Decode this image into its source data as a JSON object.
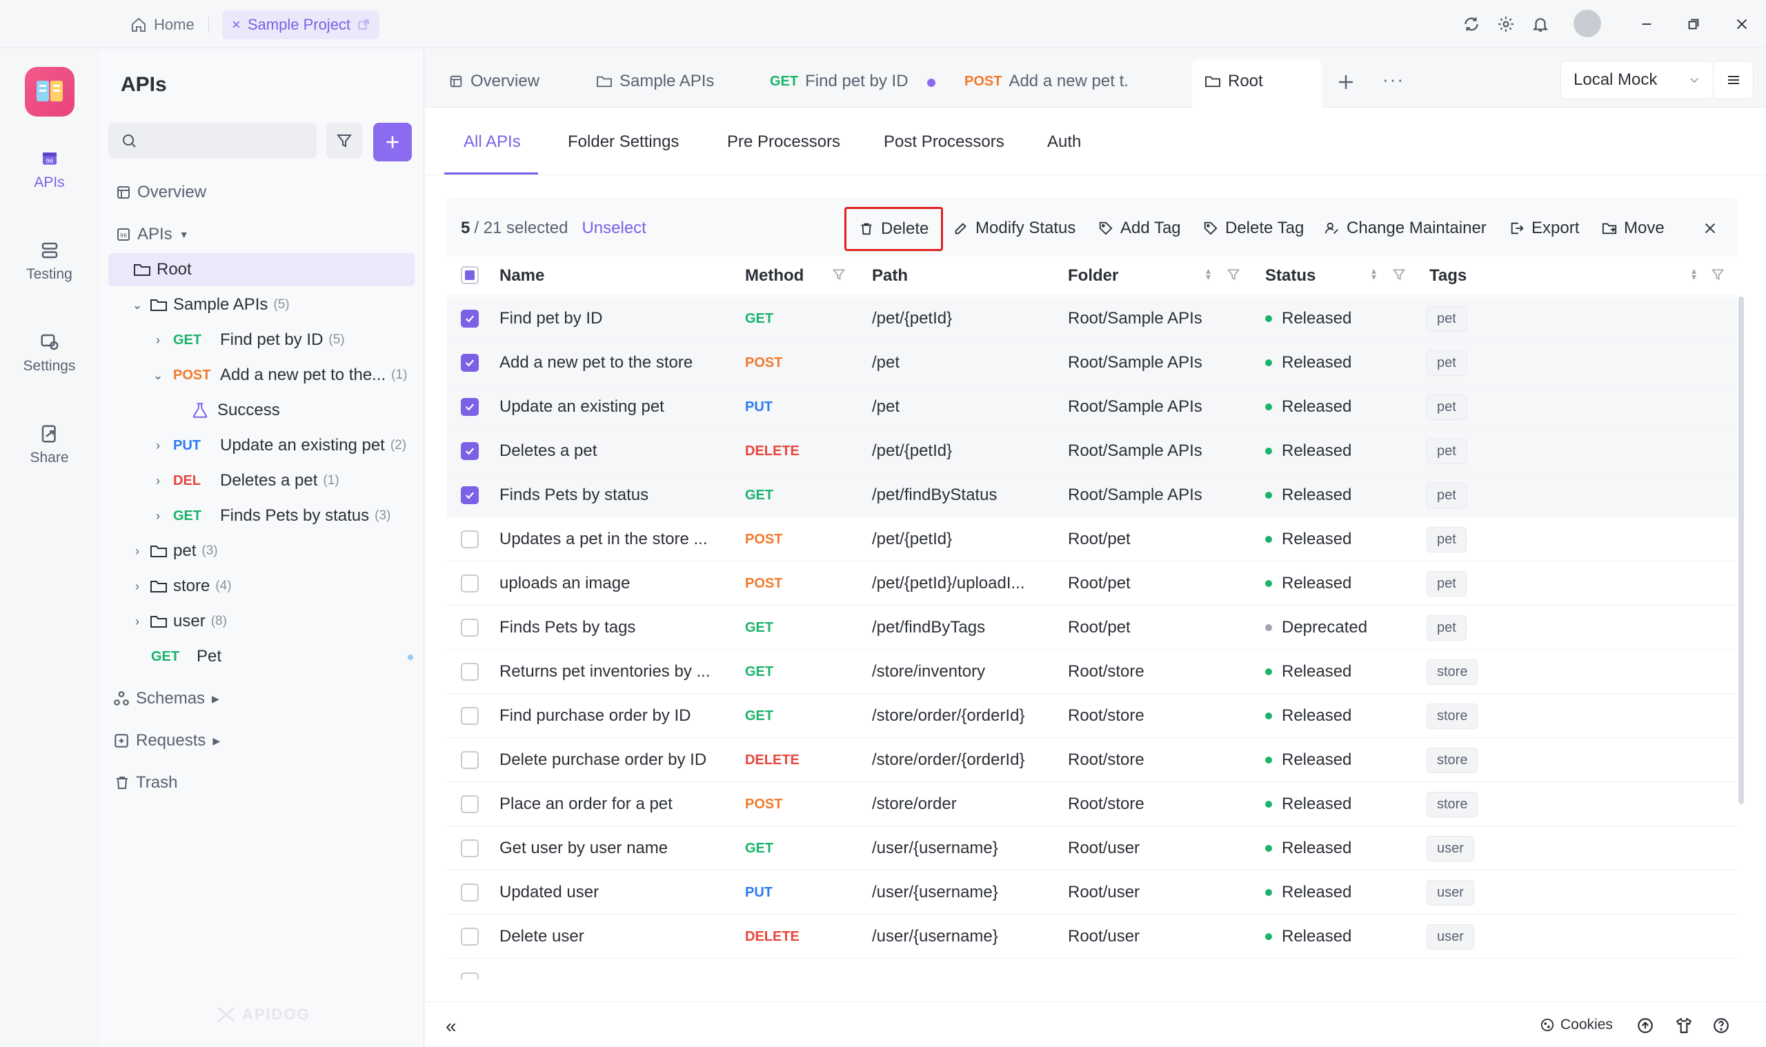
{
  "titlebar": {
    "home_label": "Home",
    "project_tab": "Sample Project"
  },
  "rail": {
    "items": [
      {
        "label": "APIs",
        "icon": "apis-icon"
      },
      {
        "label": "Testing",
        "icon": "testing-icon"
      },
      {
        "label": "Settings",
        "icon": "settings-icon"
      },
      {
        "label": "Share",
        "icon": "share-icon"
      }
    ]
  },
  "sidebar": {
    "title": "APIs",
    "search_placeholder": "",
    "tree": {
      "overview": "Overview",
      "apis": "APIs",
      "root": "Root",
      "sample_apis": {
        "label": "Sample APIs",
        "count": "(5)"
      },
      "items": [
        {
          "method": "GET",
          "name": "Find pet by ID",
          "count": "(5)"
        },
        {
          "method": "POST",
          "name": "Add a new pet to the...",
          "count": "(1)"
        },
        {
          "method": "",
          "name": "Success",
          "count": ""
        },
        {
          "method": "PUT",
          "name": "Update an existing pet",
          "count": "(2)"
        },
        {
          "method": "DEL",
          "name": "Deletes a pet",
          "count": "(1)"
        },
        {
          "method": "GET",
          "name": "Finds Pets by status",
          "count": "(3)"
        }
      ],
      "folders": [
        {
          "label": "pet",
          "count": "(3)"
        },
        {
          "label": "store",
          "count": "(4)"
        },
        {
          "label": "user",
          "count": "(8)"
        }
      ],
      "pet_endpoint": {
        "method": "GET",
        "name": "Pet"
      },
      "schemas": "Schemas",
      "requests": "Requests",
      "trash": "Trash"
    },
    "watermark": "APIDOG"
  },
  "doc_tabs": [
    {
      "method": "",
      "label": "Overview"
    },
    {
      "method": "",
      "label": "Sample APIs"
    },
    {
      "method": "GET",
      "label": "Find pet by ID"
    },
    {
      "method": "POST",
      "label": "Add a new pet t..."
    },
    {
      "method": "",
      "label": "Root"
    }
  ],
  "environment": "Local Mock",
  "sub_tabs": [
    "All APIs",
    "Folder Settings",
    "Pre Processors",
    "Post Processors",
    "Auth"
  ],
  "selection": {
    "count": "5",
    "total": "/ 21 selected",
    "unselect": "Unselect"
  },
  "actions": [
    "Delete",
    "Modify Status",
    "Add Tag",
    "Delete Tag",
    "Change Maintainer",
    "Export",
    "Move"
  ],
  "table": {
    "headers": [
      "Name",
      "Method",
      "Path",
      "Folder",
      "Status",
      "Tags"
    ],
    "rows": [
      {
        "selected": true,
        "name": "Find pet by ID",
        "method": "GET",
        "path": "/pet/{petId}",
        "folder": "Root/Sample APIs",
        "status": "Released",
        "tag": "pet"
      },
      {
        "selected": true,
        "name": "Add a new pet to the store",
        "method": "POST",
        "path": "/pet",
        "folder": "Root/Sample APIs",
        "status": "Released",
        "tag": "pet"
      },
      {
        "selected": true,
        "name": "Update an existing pet",
        "method": "PUT",
        "path": "/pet",
        "folder": "Root/Sample APIs",
        "status": "Released",
        "tag": "pet"
      },
      {
        "selected": true,
        "name": "Deletes a pet",
        "method": "DELETE",
        "path": "/pet/{petId}",
        "folder": "Root/Sample APIs",
        "status": "Released",
        "tag": "pet"
      },
      {
        "selected": true,
        "name": "Finds Pets by status",
        "method": "GET",
        "path": "/pet/findByStatus",
        "folder": "Root/Sample APIs",
        "status": "Released",
        "tag": "pet"
      },
      {
        "selected": false,
        "name": "Updates a pet in the store ...",
        "method": "POST",
        "path": "/pet/{petId}",
        "folder": "Root/pet",
        "status": "Released",
        "tag": "pet"
      },
      {
        "selected": false,
        "name": "uploads an image",
        "method": "POST",
        "path": "/pet/{petId}/uploadI...",
        "folder": "Root/pet",
        "status": "Released",
        "tag": "pet"
      },
      {
        "selected": false,
        "name": "Finds Pets by tags",
        "method": "GET",
        "path": "/pet/findByTags",
        "folder": "Root/pet",
        "status": "Deprecated",
        "tag": "pet"
      },
      {
        "selected": false,
        "name": "Returns pet inventories by ...",
        "method": "GET",
        "path": "/store/inventory",
        "folder": "Root/store",
        "status": "Released",
        "tag": "store"
      },
      {
        "selected": false,
        "name": "Find purchase order by ID",
        "method": "GET",
        "path": "/store/order/{orderId}",
        "folder": "Root/store",
        "status": "Released",
        "tag": "store"
      },
      {
        "selected": false,
        "name": "Delete purchase order by ID",
        "method": "DELETE",
        "path": "/store/order/{orderId}",
        "folder": "Root/store",
        "status": "Released",
        "tag": "store"
      },
      {
        "selected": false,
        "name": "Place an order for a pet",
        "method": "POST",
        "path": "/store/order",
        "folder": "Root/store",
        "status": "Released",
        "tag": "store"
      },
      {
        "selected": false,
        "name": "Get user by user name",
        "method": "GET",
        "path": "/user/{username}",
        "folder": "Root/user",
        "status": "Released",
        "tag": "user"
      },
      {
        "selected": false,
        "name": "Updated user",
        "method": "PUT",
        "path": "/user/{username}",
        "folder": "Root/user",
        "status": "Released",
        "tag": "user"
      },
      {
        "selected": false,
        "name": "Delete user",
        "method": "DELETE",
        "path": "/user/{username}",
        "folder": "Root/user",
        "status": "Released",
        "tag": "user"
      }
    ]
  },
  "footer": {
    "cookies": "Cookies"
  },
  "colors": {
    "accent": "#7b61e5",
    "get": "#19b36a",
    "post": "#f07a2a",
    "put": "#2a7af0",
    "delete": "#e8453c",
    "highlight": "#e02020"
  }
}
